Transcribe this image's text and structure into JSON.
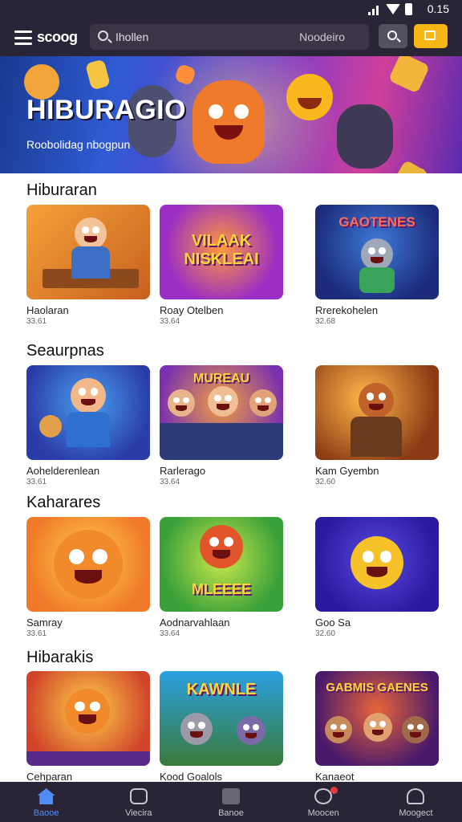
{
  "status_bar": {
    "time": "0.15"
  },
  "header": {
    "logo": "scoog",
    "search_placeholder": "Ihollen",
    "search_hint": "Noodeiro"
  },
  "hero": {
    "title": "HIBURAGIO",
    "subtitle": "Roobolidag nbogpun"
  },
  "sections": [
    {
      "title": "Hiburaran",
      "cards": [
        {
          "name": "Haolaran",
          "meta": "33.61",
          "word": ""
        },
        {
          "name": "Roay Otelben",
          "meta": "33.64",
          "word": "VILAAK NISKLEAI"
        },
        {
          "name": "Rrerekohelen",
          "meta": "32.68",
          "word": "GAOTENES"
        }
      ]
    },
    {
      "title": "Seaurpnas",
      "cards": [
        {
          "name": "Aohelderenlean",
          "meta": "33.61",
          "word": ""
        },
        {
          "name": "Rarlerago",
          "meta": "33.64",
          "word": "MUREAU"
        },
        {
          "name": "Kam Gyembn",
          "meta": "32.60",
          "word": ""
        }
      ]
    },
    {
      "title": "Kaharares",
      "cards": [
        {
          "name": "Samray",
          "meta": "33.61",
          "word": ""
        },
        {
          "name": "Aodnarvahlaan",
          "meta": "33.64",
          "word": "MLEEEE"
        },
        {
          "name": "Goo Sa",
          "meta": "32.60",
          "word": ""
        }
      ]
    },
    {
      "title": "Hibarakis",
      "cards": [
        {
          "name": "Cehparan",
          "meta": "",
          "word": ""
        },
        {
          "name": "Kood Goalols",
          "meta": "",
          "word": "KAWNLE"
        },
        {
          "name": "Kanaeot",
          "meta": "",
          "word": "GABMIS GAENES"
        }
      ]
    }
  ],
  "nav": [
    {
      "label": "Baooe",
      "icon": "home-icon"
    },
    {
      "label": "Viecira",
      "icon": "chat-icon"
    },
    {
      "label": "Banoe",
      "icon": "box-icon"
    },
    {
      "label": "Moocen",
      "icon": "bell-icon"
    },
    {
      "label": "Moogect",
      "icon": "user-icon"
    }
  ],
  "colors": {
    "header_bg": "#2a2536",
    "accent": "#f6b613",
    "nav_active": "#4f8df5"
  }
}
